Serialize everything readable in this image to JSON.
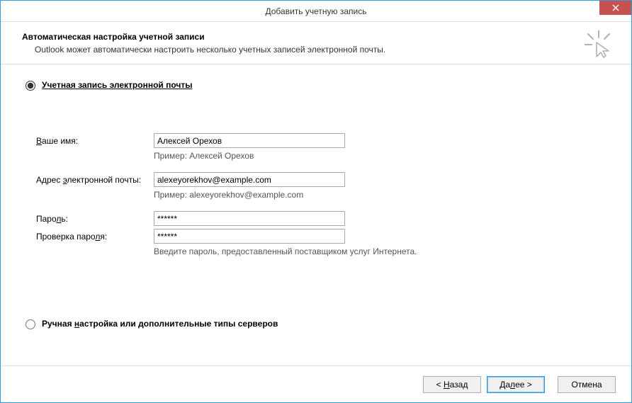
{
  "window": {
    "title": "Добавить учетную запись"
  },
  "header": {
    "title": "Автоматическая настройка учетной записи",
    "subtitle": "Outlook может автоматически настроить несколько учетных записей электронной почты."
  },
  "options": {
    "email_account": "Учетная запись электронной почты",
    "manual": "Ручная настройка или дополнительные типы серверов"
  },
  "form": {
    "name_label_pre": "В",
    "name_label_post": "аше имя:",
    "name_value": "Алексей Орехов",
    "name_hint": "Пример: Алексей Орехов",
    "email_label_pre": "Адрес ",
    "email_label_u": "э",
    "email_label_post": "лектронной почты:",
    "email_value": "alexeyorekhov@example.com",
    "email_hint": "Пример: alexeyorekhov@example.com",
    "password_label_pre": "Паро",
    "password_label_u": "л",
    "password_label_post": "ь:",
    "password_value": "******",
    "confirm_label_pre": "Проверка паро",
    "confirm_label_u": "л",
    "confirm_label_post": "я:",
    "confirm_value": "******",
    "password_hint": "Введите пароль, предоставленный поставщиком услуг Интернета."
  },
  "manual_label_pre": "Ручная ",
  "manual_label_u": "н",
  "manual_label_post": "астройка или дополнительные типы серверов",
  "footer": {
    "back_pre": "< ",
    "back_u": "Н",
    "back_post": "азад",
    "next_pre": "Да",
    "next_u": "л",
    "next_post": "ее >",
    "cancel": "Отмена"
  }
}
